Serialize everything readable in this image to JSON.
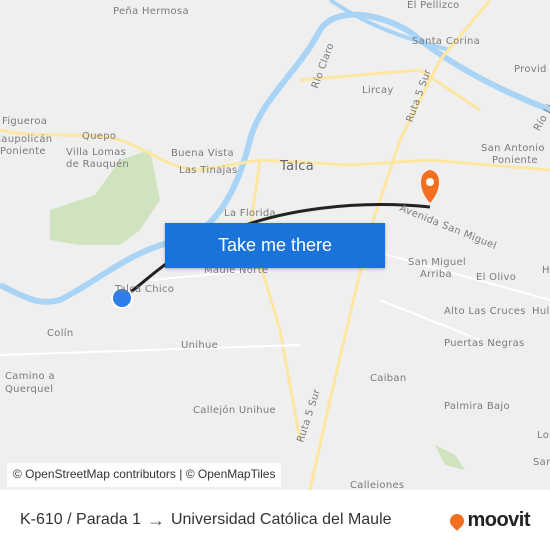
{
  "map": {
    "labels": [
      "Peña Hermosa",
      "El Pellizco",
      "Santa Corina",
      "Provid",
      "Río Claro",
      "Lircay",
      "Ruta 5 Sur",
      "Río Li",
      "Figueroa",
      "Caupolicán",
      "Poniente",
      "Quepo",
      "Villa Lomas",
      "de Rauquén",
      "Buena Vista",
      "Las Tinajas",
      "Talca",
      "San Antonio",
      "Poniente",
      "La Florida",
      "Avenida San Miguel",
      "Maule Norte",
      "Talca Chico",
      "San Miguel",
      "Arriba",
      "El Olivo",
      "H",
      "Colín",
      "Alto Las Cruces",
      "Hul",
      "Unihue",
      "Puertas Negras",
      "Camino a",
      "Querquel",
      "Caiban",
      "Palmira Bajo",
      "Ruta 5 Sur",
      "Callejón Unihue",
      "Lo",
      "San",
      "Calleiones"
    ],
    "cta_label": "Take me there",
    "attribution": "© OpenStreetMap contributors | © OpenMapTiles",
    "colors": {
      "water": "#a9d4f5",
      "road": "#fde7a0",
      "park": "#cfe3bf",
      "route": "#222222",
      "origin": "#2f7de8",
      "destination": "#f26f21",
      "cta": "#1a73d9"
    }
  },
  "footer": {
    "from": "K-610 / Parada 1",
    "arrow": "→",
    "to": "Universidad Católica del Maule",
    "brand": "moovit"
  }
}
